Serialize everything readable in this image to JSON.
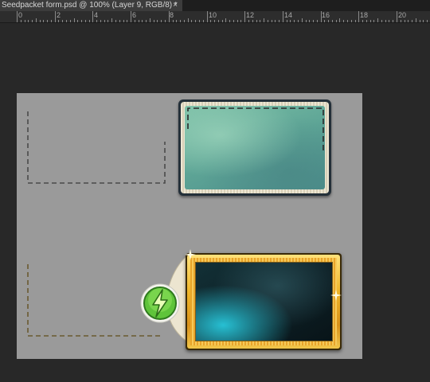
{
  "document_tab": {
    "title": "Seedpacket form.psd @ 100% (Layer 9, RGB/8) *",
    "close_glyph": "×"
  },
  "ruler": {
    "labels": [
      "0",
      "2",
      "4",
      "6",
      "8",
      "10",
      "12",
      "14",
      "16",
      "18",
      "20"
    ]
  },
  "canvas": {
    "background": "#9a9a9a",
    "top_card": {
      "border_color": "#243039",
      "fill_color": "#6aae9c"
    },
    "bottom_card": {
      "border_color": "#e9a92a",
      "fill_color": "#0f2a30"
    },
    "badge_icon": "lightning-bolt-icon",
    "dash_top_color": "#4a4a4a",
    "dash_bottom_color": "#6a5a30"
  },
  "colors": {
    "workspace": "#282828",
    "tab_active": "#3c3c3c",
    "badge_green": "#5fc43a"
  }
}
